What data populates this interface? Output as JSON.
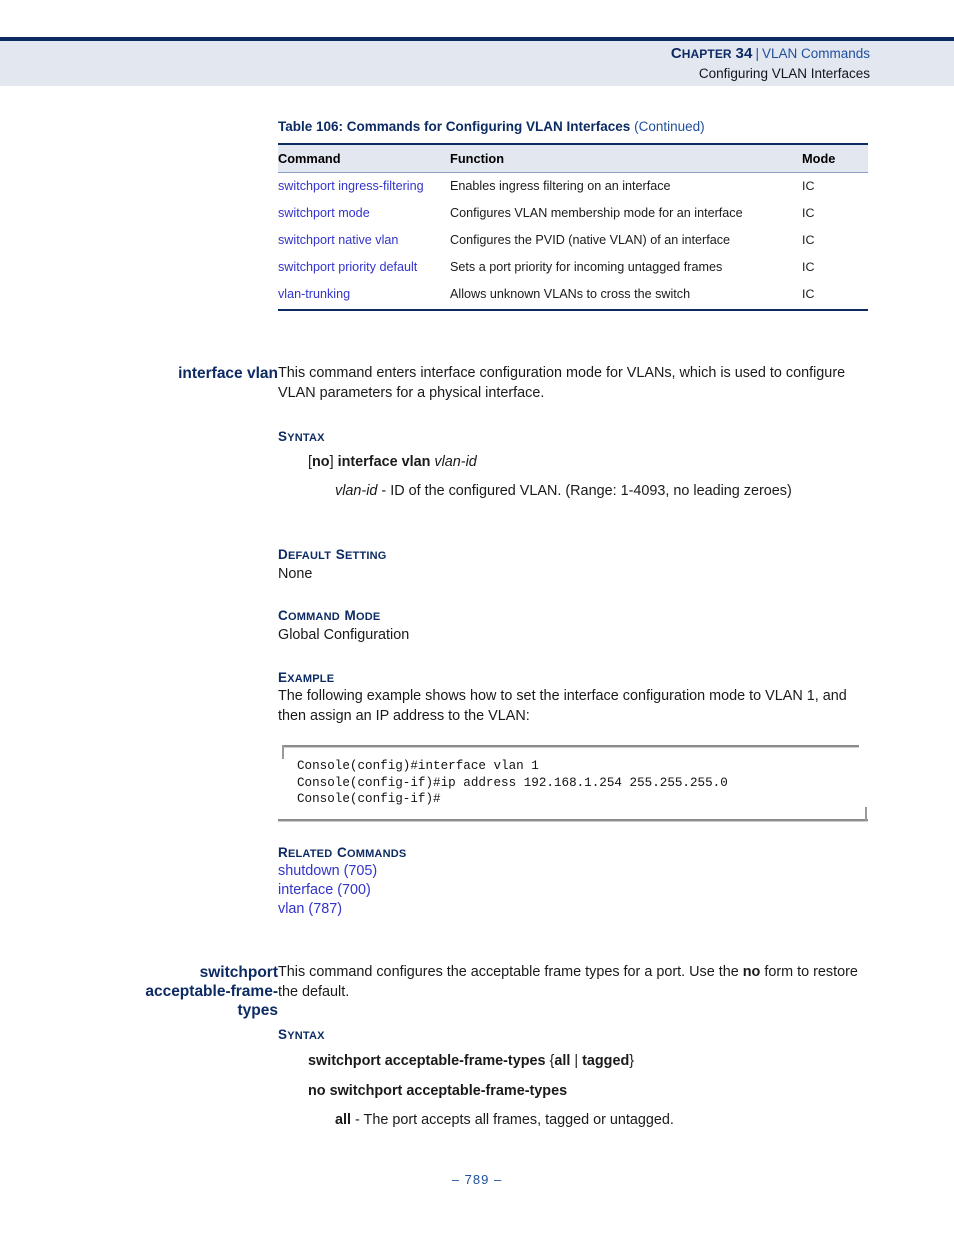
{
  "header": {
    "chapter_label": "Chapter 34",
    "chapter_label_lead": "C",
    "chapter_label_rest": "HAPTER",
    "chapter_number": "34",
    "separator": "|",
    "chapter_title": "VLAN Commands",
    "section_title": "Configuring VLAN Interfaces"
  },
  "table": {
    "caption_main": "Table 106: Commands for Configuring VLAN Interfaces",
    "caption_continued": "(Continued)",
    "columns": [
      "Command",
      "Function",
      "Mode"
    ],
    "rows": [
      {
        "command": "switchport ingress-filtering",
        "function": "Enables ingress filtering on an interface",
        "mode": "IC"
      },
      {
        "command": "switchport mode",
        "function": "Configures VLAN membership mode for an interface",
        "mode": "IC"
      },
      {
        "command": "switchport native vlan",
        "function": "Configures the PVID (native VLAN) of an interface",
        "mode": "IC"
      },
      {
        "command": "switchport priority default",
        "function": "Sets a port priority for incoming untagged frames",
        "mode": "IC"
      },
      {
        "command": "vlan-trunking",
        "function": "Allows unknown VLANs to cross the switch",
        "mode": "IC"
      }
    ]
  },
  "section_interface_vlan": {
    "label": "interface vlan",
    "description": "This command enters interface configuration mode for VLANs, which is used to configure VLAN parameters for a physical interface.",
    "syntax_heading": "Syntax",
    "syntax_heading_lead": "S",
    "syntax_heading_rest": "YNTAX",
    "syntax_line_open": "[",
    "syntax_line_no": "no",
    "syntax_line_close": "]",
    "syntax_line_cmd": "interface vlan",
    "syntax_line_param": "vlan-id",
    "param_name": "vlan-id",
    "param_desc": " - ID of the configured VLAN. (Range: 1-4093, no leading zeroes)",
    "default_heading_lead": "D",
    "default_heading_rest": "EFAULT",
    "default_heading_lead2": "S",
    "default_heading_rest2": "ETTING",
    "default_value": "None",
    "cmdmode_heading_lead": "C",
    "cmdmode_heading_rest": "OMMAND",
    "cmdmode_heading_lead2": "M",
    "cmdmode_heading_rest2": "ODE",
    "cmdmode_value": "Global Configuration",
    "example_heading_lead": "E",
    "example_heading_rest": "XAMPLE",
    "example_desc": "The following example shows how to set the interface configuration mode to VLAN 1, and then assign an IP address to the VLAN:",
    "console_lines": "Console(config)#interface vlan 1\nConsole(config-if)#ip address 192.168.1.254 255.255.255.0\nConsole(config-if)#",
    "related_heading_lead": "R",
    "related_heading_rest": "ELATED",
    "related_heading_lead2": "C",
    "related_heading_rest2": "OMMANDS",
    "related_commands": [
      "shutdown (705)",
      "interface (700)",
      "vlan (787)"
    ]
  },
  "section_switchport_aft": {
    "label_line1": "switchport",
    "label_line2": "acceptable-frame-",
    "label_line3": "types",
    "description_part1": "This command configures the acceptable frame types for a port. Use the ",
    "description_bold": "no",
    "description_part2": " form to restore the default.",
    "syntax_heading_lead": "S",
    "syntax_heading_rest": "YNTAX",
    "syntax_line1_cmd": "switchport acceptable-frame-types",
    "syntax_line1_open": "{",
    "syntax_line1_opt1": "all",
    "syntax_line1_pipe": "|",
    "syntax_line1_opt2": "tagged",
    "syntax_line1_close": "}",
    "syntax_line2": "no switchport acceptable-frame-types",
    "param_name": "all",
    "param_desc": " - The port accepts all frames, tagged or untagged."
  },
  "footer": {
    "page_number": "– 789 –"
  },
  "colors": {
    "navy": "#0d2b63",
    "link_blue": "#3333cc",
    "header_band": "#e3e7f0",
    "accent_blue": "#1d4f9e"
  }
}
